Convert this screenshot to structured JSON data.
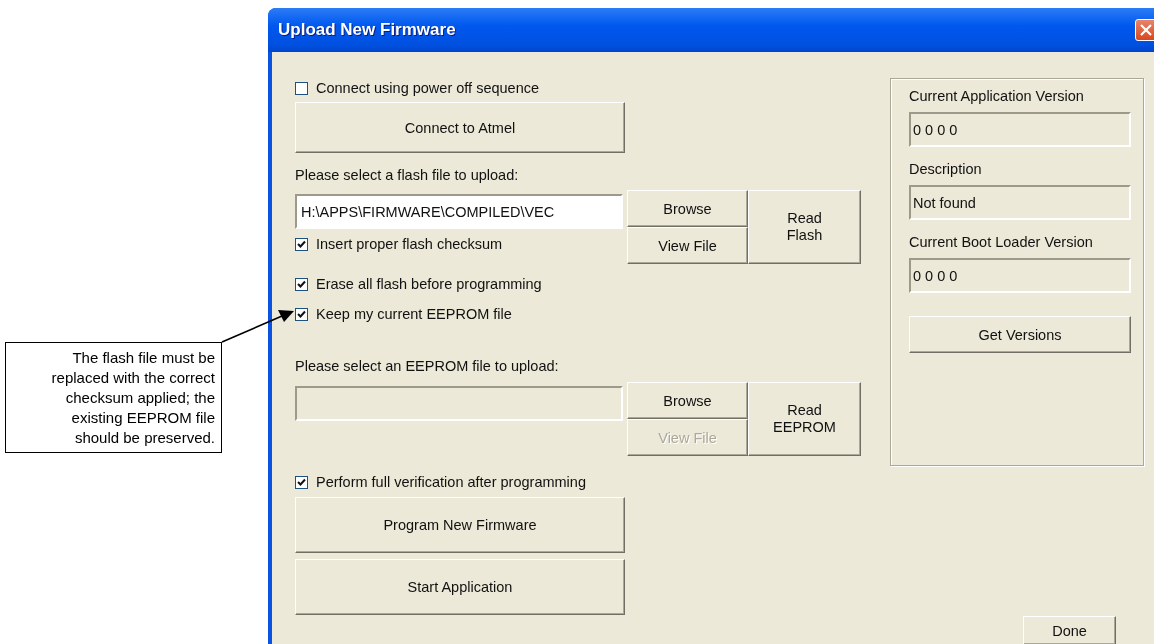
{
  "window": {
    "title": "Upload New Firmware"
  },
  "power_off": {
    "label": "Connect using power off sequence",
    "checked": false
  },
  "connect_button": "Connect to Atmel",
  "flash": {
    "label": "Please select a flash file to upload:",
    "value": "H:\\APPS\\FIRMWARE\\COMPILED\\VEC",
    "disabled": false,
    "buttons": [
      {
        "label": "Browse",
        "disabled": false
      },
      {
        "label": "View File",
        "disabled": false
      }
    ],
    "read_button": "Read Flash",
    "options": [
      {
        "label": "Insert proper flash checksum",
        "checked": true
      },
      {
        "label": "Erase all flash before programming",
        "checked": true
      },
      {
        "label": "Keep my current EEPROM file",
        "checked": true
      }
    ]
  },
  "eeprom": {
    "label": "Please select an EEPROM file to upload:",
    "disabled": true,
    "buttons": [
      {
        "label": "Browse",
        "disabled": false
      },
      {
        "label": "View File",
        "disabled": true
      }
    ],
    "read_button": "Read EEPROM"
  },
  "verify": {
    "label": "Perform full verification after programming",
    "checked": true
  },
  "actions": [
    "Program New Firmware",
    "Start Application"
  ],
  "versions": {
    "fields": [
      {
        "label": "Current Application Version",
        "value": "0 0 0 0"
      },
      {
        "label": "Description",
        "value": "Not found"
      },
      {
        "label": "Current Boot Loader Version",
        "value": "0 0 0 0"
      }
    ],
    "button": "Get Versions"
  },
  "done_button": "Done",
  "callout": {
    "text": "The flash file must be replaced with the correct checksum applied; the existing EEPROM file should be preserved."
  }
}
